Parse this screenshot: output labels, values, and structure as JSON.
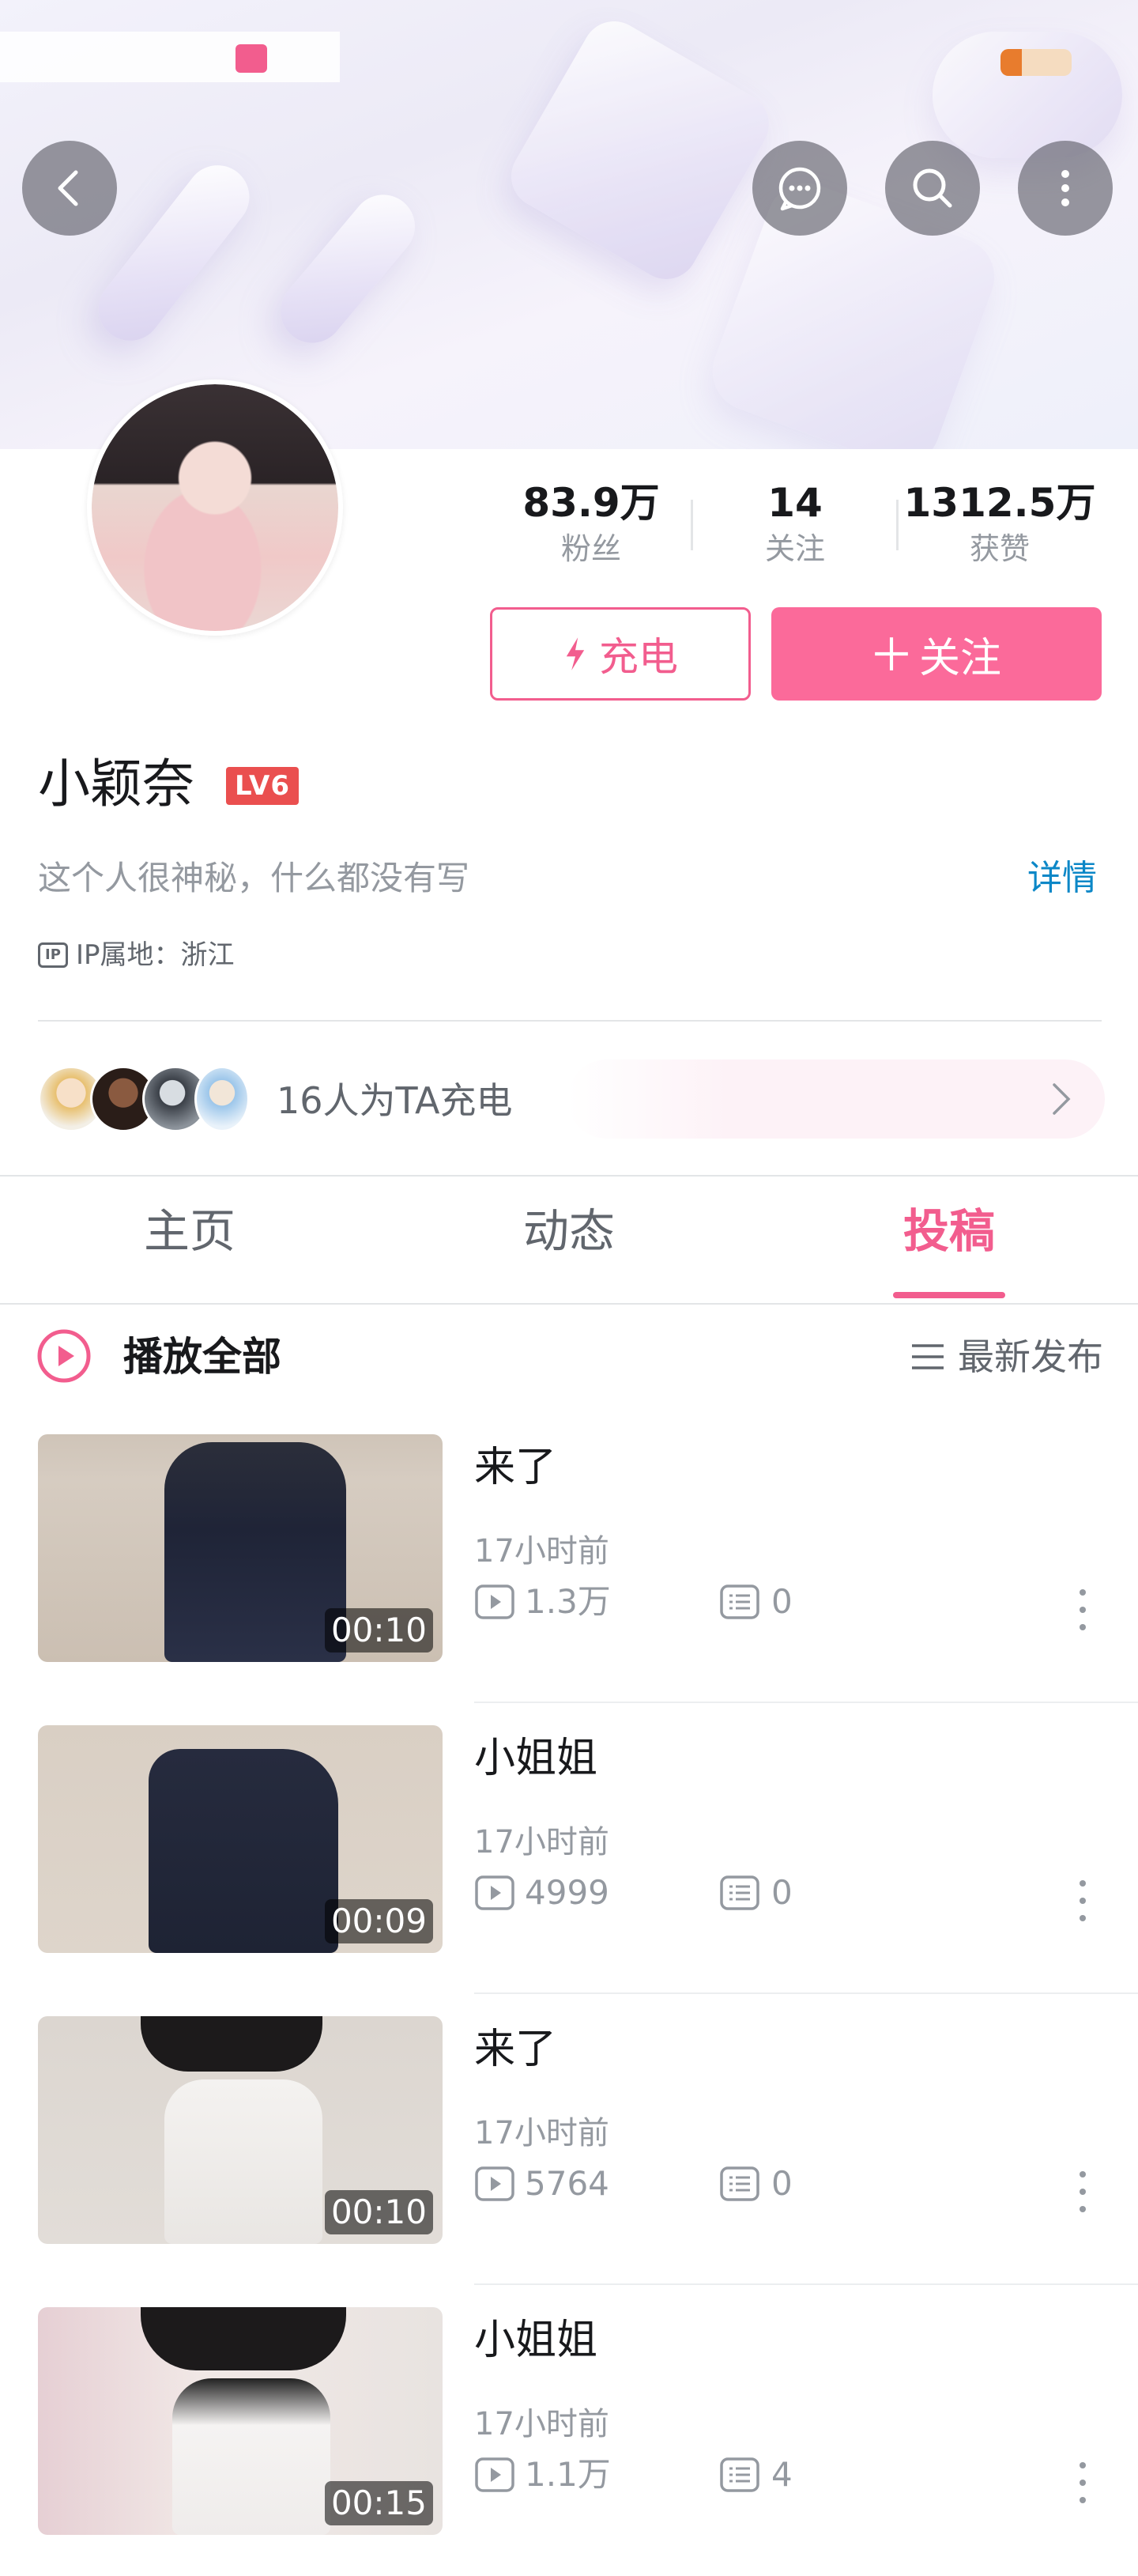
{
  "status_bar": {
    "app_badge": "bili",
    "battery_level": 0.3
  },
  "header": {
    "back_icon": "chevron-left-icon",
    "message_icon": "chat-bubble-icon",
    "search_icon": "search-icon",
    "more_icon": "more-vertical-icon"
  },
  "profile": {
    "name": "小颖奈",
    "level": "LV6",
    "signature": "这个人很神秘，什么都没有写",
    "detail_link": "详情",
    "ip_label": "IP属地：浙江",
    "ip_icon_text": "IP"
  },
  "stats": [
    {
      "value": "83.9万",
      "label": "粉丝"
    },
    {
      "value": "14",
      "label": "关注"
    },
    {
      "value": "1312.5万",
      "label": "获赞"
    }
  ],
  "buttons": {
    "charge": "充电",
    "follow": "关注"
  },
  "chargers": {
    "text": "16人为TA充电"
  },
  "tabs": [
    {
      "label": "主页",
      "active": false
    },
    {
      "label": "动态",
      "active": false
    },
    {
      "label": "投稿",
      "active": true
    }
  ],
  "playlist": {
    "play_all": "播放全部",
    "sort": "最新发布"
  },
  "videos": [
    {
      "title": "来了",
      "duration": "00:10",
      "time": "17小时前",
      "plays": "1.3万",
      "comments": "0"
    },
    {
      "title": "小姐姐",
      "duration": "00:09",
      "time": "17小时前",
      "plays": "4999",
      "comments": "0"
    },
    {
      "title": "来了",
      "duration": "00:10",
      "time": "17小时前",
      "plays": "5764",
      "comments": "0"
    },
    {
      "title": "小姐姐",
      "duration": "00:15",
      "time": "17小时前",
      "plays": "1.1万",
      "comments": "4"
    }
  ],
  "colors": {
    "accent": "#f25d8e",
    "follow_bg": "#fb6a9a",
    "link": "#0b87c7",
    "level_badge": "#ea4f4f"
  }
}
